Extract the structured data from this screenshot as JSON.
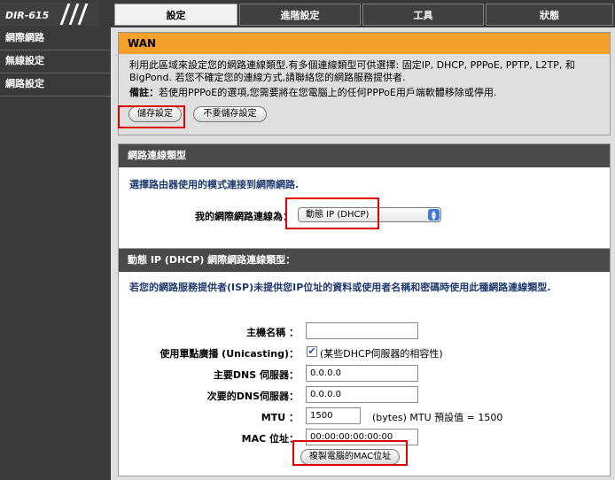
{
  "header": {
    "logo": "DIR-615",
    "tabs": [
      "設定",
      "進階設定",
      "工具",
      "狀態"
    ]
  },
  "sidebar": {
    "items": [
      "網際網路",
      "無線設定",
      "網路設定"
    ]
  },
  "wan": {
    "title": "WAN",
    "description": "利用此區域來設定您的網路連線類型.有多個連線類型可供選擇: 固定IP, DHCP, PPPoE, PPTP, L2TP, 和 BigPond. 若您不確定您的連線方式,請聯絡您的網路服務提供者.",
    "note_label": "備註：",
    "note": "若使用PPPoE的選項,您需要將在您電腦上的任何PPPoE用戶端軟體移除或停用.",
    "save_label": "儲存設定",
    "nosave_label": "不要儲存設定"
  },
  "conn_type": {
    "title": "網路連線類型",
    "desc": "選擇路由器使用的模式連接到網際網路.",
    "label": "我的網際網路連線為：",
    "selected": "動態 IP (DHCP)"
  },
  "dhcp": {
    "title": "動態 IP (DHCP) 網際網路連線類型：",
    "desc": "若您的網路服務提供者(ISP)未提供您IP位址的資料或使用者名稱和密碼時使用此種網路連線類型.",
    "host_label": "主機名稱 ：",
    "host_value": "",
    "unicast_label": "使用單點廣播 (Unicasting)：",
    "unicast_checked": "✔",
    "unicast_hint": "(某些DHCP伺服器的相容性)",
    "dns1_label": "主要DNS 伺服器：",
    "dns1_value": "0.0.0.0",
    "dns2_label": "次要的DNS伺服器：",
    "dns2_value": "0.0.0.0",
    "mtu_label": "MTU ：",
    "mtu_value": "1500",
    "mtu_hint": "(bytes) MTU 預設值 = 1500",
    "mac_label": "MAC 位址：",
    "mac_value": "00:00:00:00:00:00",
    "clone_label": "複製電腦的MAC位址"
  },
  "colors": {
    "orange_header": "#f5a02a",
    "dark_header": "#4a4a4a",
    "highlight_red": "#e00000",
    "link_blue": "#1f3a6e"
  }
}
